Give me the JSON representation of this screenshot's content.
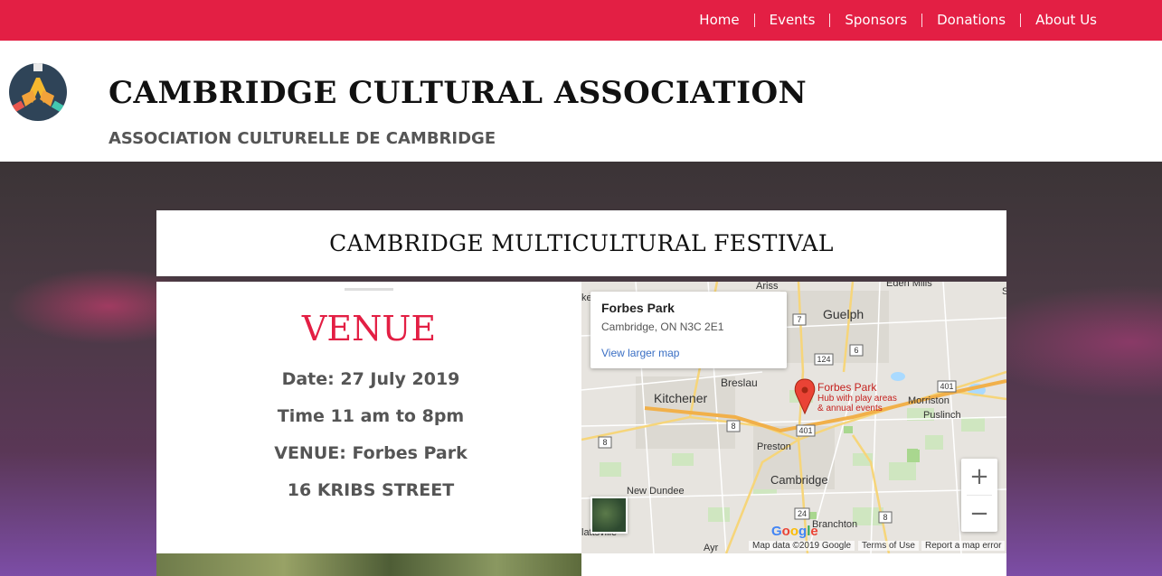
{
  "nav": {
    "items": [
      "Home",
      "Events",
      "Sponsors",
      "Donations",
      "About Us"
    ]
  },
  "header": {
    "title": "CAMBRIDGE CULTURAL ASSOCIATION",
    "subtitle": "ASSOCIATION CULTURELLE DE CAMBRIDGE",
    "logo_icon": "hands-logo-icon"
  },
  "event": {
    "title": "CAMBRIDGE MULTICULTURAL FESTIVAL"
  },
  "venue": {
    "heading": "VENUE",
    "date": "Date: 27 July 2019",
    "time": "Time 11 am to 8pm",
    "venue": "VENUE: Forbes Park",
    "address": "16 KRIBS STREET"
  },
  "map": {
    "info_title": "Forbes Park",
    "info_address": "Cambridge, ON N3C 2E1",
    "info_link": "View larger map",
    "pin_title": "Forbes Park",
    "pin_desc_1": "Hub with play areas",
    "pin_desc_2": "& annual events",
    "places": {
      "ariss": "Ariss",
      "eden_mills": "Eden Mills",
      "guelph": "Guelph",
      "breslau": "Breslau",
      "kitchener": "Kitchener",
      "morriston": "Morriston",
      "puslinch": "Puslinch",
      "preston": "Preston",
      "cambridge": "Cambridge",
      "new_dundee": "New Dundee",
      "branchton": "Branchton",
      "ayr": "Ayr",
      "plattsville": "lattsville",
      "s_edge": "S",
      "ke": "ke"
    },
    "shields": [
      "7",
      "6",
      "124",
      "401",
      "401",
      "8",
      "8",
      "24",
      "8",
      "8"
    ],
    "zoom_in": "+",
    "zoom_out": "−",
    "google": "Google",
    "map_data": "Map data ©2019 Google",
    "terms": "Terms of Use",
    "report": "Report a map error"
  },
  "colors": {
    "brand_red": "#e31f44",
    "link_blue": "#3a6fc4"
  }
}
